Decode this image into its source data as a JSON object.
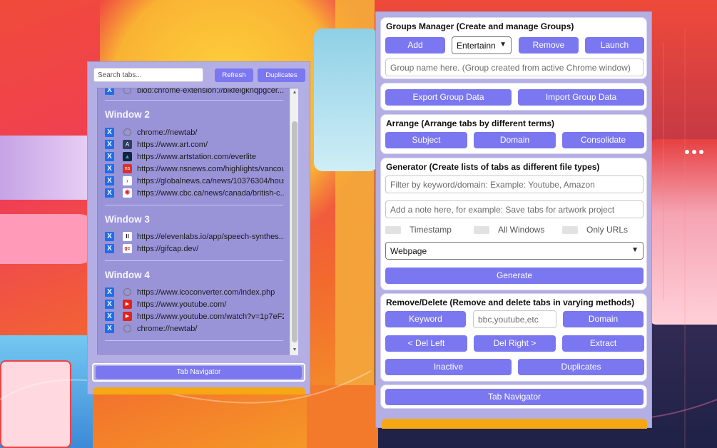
{
  "left_popup": {
    "search_placeholder": "Search tabs...",
    "refresh_label": "Refresh",
    "duplicates_label": "Duplicates",
    "partial_row_url": "blob:chrome-extension://bikfeigknqpgcer...",
    "windows": [
      {
        "title": "Window 2",
        "tabs": [
          {
            "url": "chrome://newtab/",
            "icon": "blank-circle-icon"
          },
          {
            "url": "https://www.art.com/",
            "icon": "art-icon"
          },
          {
            "url": "https://www.artstation.com/everlite",
            "icon": "artstation-icon"
          },
          {
            "url": "https://www.nsnews.com/highlights/vancou",
            "icon": "nsnews-icon"
          },
          {
            "url": "https://globalnews.ca/news/10376304/hous",
            "icon": "globalnews-icon"
          },
          {
            "url": "https://www.cbc.ca/news/canada/british-c...",
            "icon": "cbc-icon"
          }
        ]
      },
      {
        "title": "Window 3",
        "tabs": [
          {
            "url": "https://elevenlabs.io/app/speech-synthes...",
            "icon": "elevenlabs-icon"
          },
          {
            "url": "https://gifcap.dev/",
            "icon": "gifcap-icon"
          }
        ]
      },
      {
        "title": "Window 4",
        "tabs": [
          {
            "url": "https://www.icoconverter.com/index.php",
            "icon": "blank-circle-icon"
          },
          {
            "url": "https://www.youtube.com/",
            "icon": "youtube-icon"
          },
          {
            "url": "https://www.youtube.com/watch?v=1p7eF2",
            "icon": "youtube-icon"
          },
          {
            "url": "chrome://newtab/",
            "icon": "blank-circle-icon"
          }
        ]
      }
    ],
    "close_glyph": "X",
    "tab_navigator_label": "Tab Navigator"
  },
  "right_popup": {
    "groups": {
      "title": "Groups Manager (Create and manage Groups)",
      "add_label": "Add",
      "select_value": "Entertainn",
      "remove_label": "Remove",
      "launch_label": "Launch",
      "name_placeholder": "Group name here. (Group created from active Chrome window)"
    },
    "data": {
      "export_label": "Export Group Data",
      "import_label": "Import Group Data"
    },
    "arrange": {
      "title": "Arrange (Arrange tabs by different terms)",
      "subject_label": "Subject",
      "domain_label": "Domain",
      "consolidate_label": "Consolidate"
    },
    "generator": {
      "title": "Generator (Create lists of tabs as different file types)",
      "filter_placeholder": "Filter by keyword/domain: Example: Youtube, Amazon",
      "note_placeholder": "Add a note here, for example: Save tabs for artwork project",
      "timestamp_label": "Timestamp",
      "all_windows_label": "All Windows",
      "only_urls_label": "Only URLs",
      "format_value": "Webpage",
      "generate_label": "Generate"
    },
    "remove": {
      "title": "Remove/Delete (Remove and delete tabs in varying methods)",
      "keyword_label": "Keyword",
      "keyword_placeholder": "bbc,youtube,etc",
      "domain_label": "Domain",
      "del_left_label": "< Del Left",
      "del_right_label": "Del Right >",
      "extract_label": "Extract",
      "inactive_label": "Inactive",
      "duplicates_label": "Duplicates"
    },
    "tab_navigator_label": "Tab Navigator"
  },
  "colors": {
    "button": "#7b77f0",
    "panel": "#b3aee4",
    "close_badge": "#1e6ee8",
    "accent_bar": "#f5a814"
  }
}
